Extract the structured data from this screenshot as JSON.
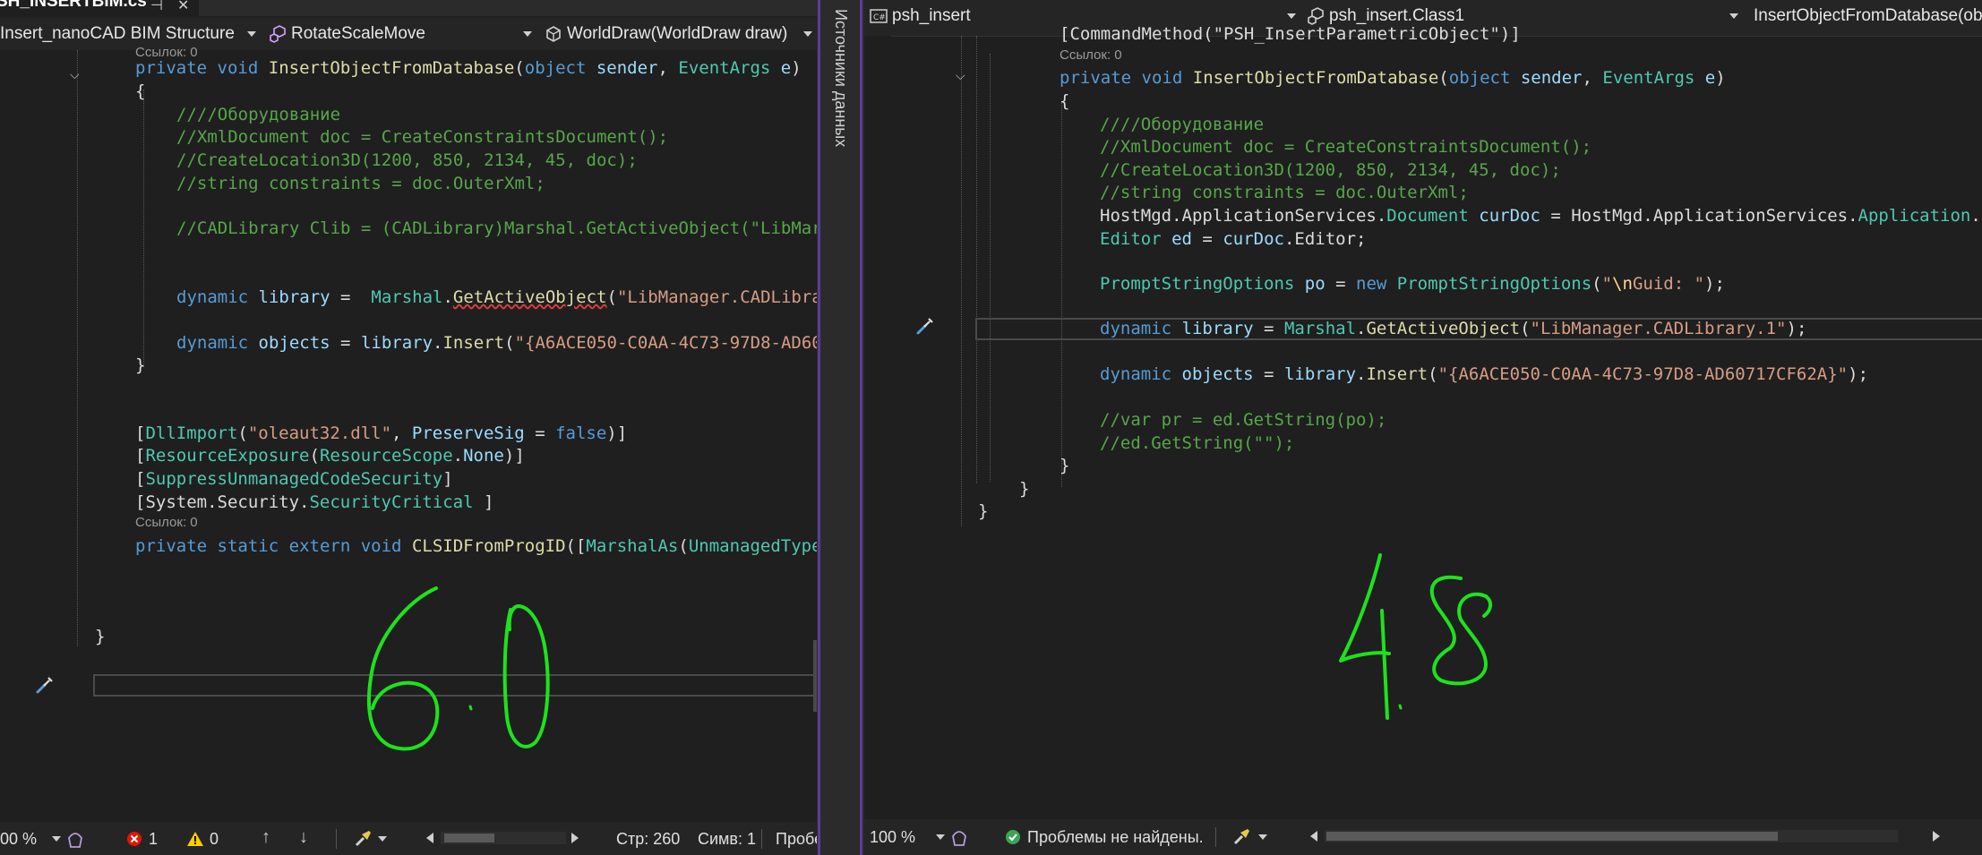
{
  "left": {
    "tab": {
      "title": "SH_INSERTBIM.cs",
      "pin": "⊣",
      "close": "✕"
    },
    "nav": {
      "project": "Insert_nanoCAD BIM Structure",
      "class": "RotateScaleMove",
      "member": "WorldDraw(WorldDraw draw)"
    },
    "code": {
      "lens_top": "Ссылок: 0",
      "sig_private": "private",
      "sig_void": "void",
      "sig_name": "InsertObjectFromDatabase",
      "sig_obj": "object",
      "sig_sender": "sender",
      "sig_ea": "EventArgs",
      "sig_e": "e",
      "brace_open": "{",
      "c1": "////Оборудование",
      "c2": "//XmlDocument doc = CreateConstraintsDocument();",
      "c3": "//CreateLocation3D(1200, 850, 2134, 45, doc);",
      "c4": "//string constraints = doc.OuterXml;",
      "c5": "//CADLibrary Clib = (CADLibrary)Marshal.GetActiveObject(\"LibMar",
      "dyn1_kw": "dynamic",
      "dyn1_var": "library",
      "dyn1_eq": " =  ",
      "dyn1_cls": "Marshal",
      "dyn1_dot": ".",
      "dyn1_fn": "GetActiveObject",
      "dyn1_p": "(",
      "dyn1_str": "\"LibManager.CADLibra",
      "dyn2_kw": "dynamic",
      "dyn2_var": "objects",
      "dyn2_eq": " = ",
      "dyn2_lib": "library",
      "dyn2_dot": ".",
      "dyn2_fn": "Insert",
      "dyn2_p": "(",
      "dyn2_str": "\"{A6ACE050-C0AA-4C73-97D8-AD60",
      "brace_close": "}",
      "a1_open": "[",
      "a1_cls": "DllImport",
      "a1_p": "(",
      "a1_str": "\"oleaut32.dll\"",
      "a1_mid": ", ",
      "a1_param": "PreserveSig",
      "a1_eq": " = ",
      "a1_false": "false",
      "a1_end": ")]",
      "a2_open": "[",
      "a2_cls": "ResourceExposure",
      "a2_p": "(",
      "a2_cls2": "ResourceScope",
      "a2_dot": ".",
      "a2_none": "None",
      "a2_end": ")]",
      "a3_open": "[",
      "a3_cls": "SuppressUnmanagedCodeSecurity",
      "a3_end": "]",
      "a4_open": "[",
      "a4_ns": "System.Security.",
      "a4_cls": "SecurityCritical",
      "a4_end": " ]",
      "lens2": "Ссылок: 0",
      "ext_private": "private",
      "ext_static": "static",
      "ext_extern": "extern",
      "ext_void": "void",
      "ext_fn": "CLSIDFromProgID",
      "ext_p": "([",
      "ext_cls": "MarshalAs",
      "ext_p2": "(",
      "ext_cls2": "UnmanagedType",
      "ns_close": "}"
    },
    "status": {
      "zoom": "00 %",
      "errors": "1",
      "warnings": "0",
      "line": "Стр: 260",
      "col": "Симв: 1",
      "problems": "Пробе"
    },
    "handwriting": "6.0"
  },
  "splitter": {
    "label": "Источники данных"
  },
  "right": {
    "nav": {
      "project": "psh_insert",
      "class": "psh_insert.Class1",
      "member": "InsertObjectFromDatabase(obj"
    },
    "code": {
      "attr": "[CommandMethod(\"PSH_InsertParametricObject\")]",
      "lens": "Ссылок: 0",
      "sig_private": "private",
      "sig_void": "void",
      "sig_name": "InsertObjectFromDatabase",
      "sig_obj": "object",
      "sig_sender": "sender",
      "sig_ea": "EventArgs",
      "sig_e": "e",
      "brace_open": "{",
      "c1": "////Оборудование",
      "c2": "//XmlDocument doc = CreateConstraintsDocument();",
      "c3": "//CreateLocation3D(1200, 850, 2134, 45, doc);",
      "c4": "//string constraints = doc.OuterXml;",
      "hm_ns": "HostMgd.ApplicationServices.",
      "hm_cls": "Document",
      "hm_var": "curDoc",
      "hm_eq": " = HostMgd.ApplicationServices.",
      "hm_cls2": "Application",
      "hm_tail": ".D",
      "ed_cls": "Editor",
      "ed_var": "ed",
      "ed_eq": " = ",
      "ed_var2": "curDoc",
      "ed_tail": ".Editor;",
      "ps_cls": "PromptStringOptions",
      "ps_var": "po",
      "ps_eq": " = ",
      "ps_new": "new",
      "ps_cls2": "PromptStringOptions",
      "ps_p": "(",
      "ps_str1": "\"",
      "ps_esc": "\\n",
      "ps_str2": "Guid: \"",
      "ps_end": ");",
      "dyn1_kw": "dynamic",
      "dyn1_var": "library",
      "dyn1_eq": " = ",
      "dyn1_cls": "Marshal",
      "dyn1_dot": ".",
      "dyn1_fn": "GetActiveObject",
      "dyn1_p": "(",
      "dyn1_str": "\"LibManager.CADLibrary.1\"",
      "dyn1_end": ");",
      "dyn2_kw": "dynamic",
      "dyn2_var": "objects",
      "dyn2_eq": " = ",
      "dyn2_lib": "library",
      "dyn2_dot": ".",
      "dyn2_fn": "Insert",
      "dyn2_p": "(",
      "dyn2_str": "\"{A6ACE050-C0AA-4C73-97D8-AD60717CF62A}\"",
      "dyn2_end": ");",
      "c5": "//var pr = ed.GetString(po);",
      "c6": "//ed.GetString(\"\");",
      "brace_close": "}",
      "class_close": "}",
      "ns_close": "}"
    },
    "status": {
      "zoom": "100 %",
      "problems": "Проблемы не найдены."
    },
    "handwriting": "4.8"
  },
  "colors": {
    "accent": "#5a3d99",
    "handwriting": "#1de21d",
    "keyword": "#569cd6",
    "type": "#4ec9b0",
    "string": "#d69d85",
    "comment": "#57a64a"
  }
}
